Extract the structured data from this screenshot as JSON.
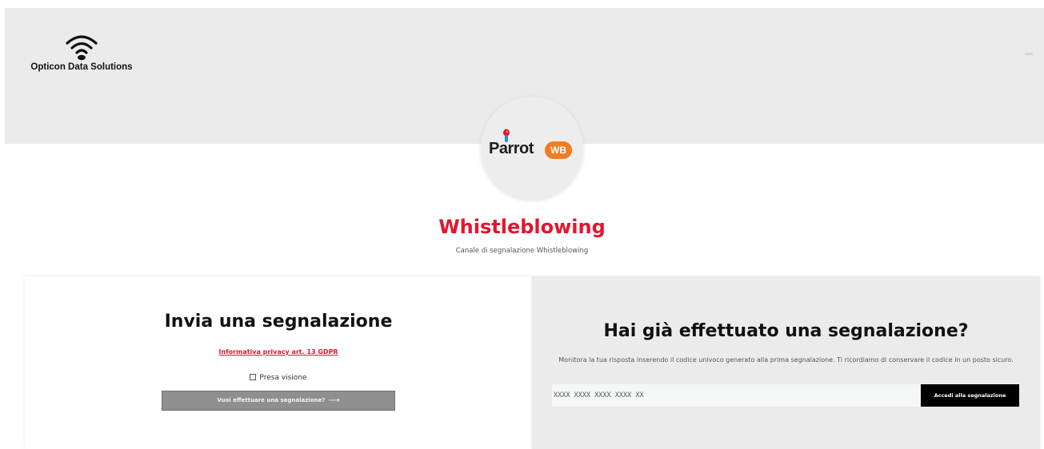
{
  "header": {
    "company_name": "Opticon Data Solutions",
    "company_icon": "wifi-icon",
    "app_logo": {
      "wordmark": "Parrot",
      "badge": "WB",
      "colors": {
        "badge": "#ef7d22",
        "bird": "#e3152d"
      }
    }
  },
  "hero": {
    "title": "Whistleblowing",
    "subtitle": "Canale di segnalazione Whistleblowing",
    "title_color": "#e3152d"
  },
  "send_report": {
    "title": "Invia una segnalazione",
    "privacy_link": "Informativa privacy art. 13 GDPR",
    "consent_label": "Presa visione",
    "button_label": "Vuoi effettuare una segnalazione?",
    "button_icon": "arrow-right-icon"
  },
  "existing_report": {
    "title": "Hai già effettuato una segnalazione?",
    "description": "Monitora la tua risposta inserendo il codice univoco generato alla prima segnalazione. Ti ricordiamo di conservare il codice in un posto sicuro.",
    "code_placeholder": "XXXX XXXX XXXX XXXX XX",
    "button_label": "Accedi alla segnalazione"
  },
  "colors": {
    "accent": "#e3152d",
    "header_bg": "#ebebeb",
    "primary_button": "#000000",
    "disabled_button": "#8f8f8f"
  }
}
